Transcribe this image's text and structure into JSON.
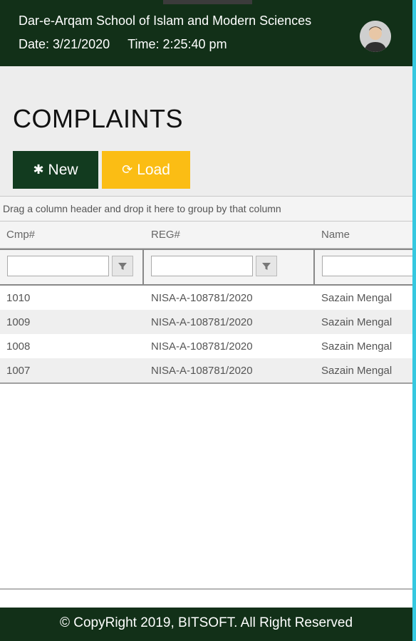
{
  "header": {
    "school_name": "Dar-e-Arqam School of Islam and Modern Sciences",
    "date_label": "Date:",
    "date_value": "3/21/2020",
    "time_label": "Time:",
    "time_value": "2:25:40 pm",
    "avatar_icon": "user-avatar-icon"
  },
  "page": {
    "title": "COMPLAINTS",
    "new_button": {
      "icon": "asterisk-icon",
      "label": "New"
    },
    "load_button": {
      "icon": "refresh-icon",
      "label": "Load"
    }
  },
  "grid": {
    "group_panel_text": "Drag a column header and drop it here to group by that column",
    "columns": [
      "Cmp#",
      "REG#",
      "Name"
    ],
    "rows": [
      {
        "cmp": "1010",
        "reg": "NISA-A-108781/2020",
        "name": "Sazain Mengal"
      },
      {
        "cmp": "1009",
        "reg": "NISA-A-108781/2020",
        "name": "Sazain Mengal"
      },
      {
        "cmp": "1008",
        "reg": "NISA-A-108781/2020",
        "name": "Sazain Mengal"
      },
      {
        "cmp": "1007",
        "reg": "NISA-A-108781/2020",
        "name": "Sazain Mengal"
      }
    ]
  },
  "footer": {
    "text": "© CopyRight 2019, BITSOFT. All Right Reserved"
  },
  "colors": {
    "header_bg": "#123018",
    "new_button_bg": "#123b1f",
    "load_button_bg": "#fbbd14",
    "edge": "#35c8e0"
  }
}
